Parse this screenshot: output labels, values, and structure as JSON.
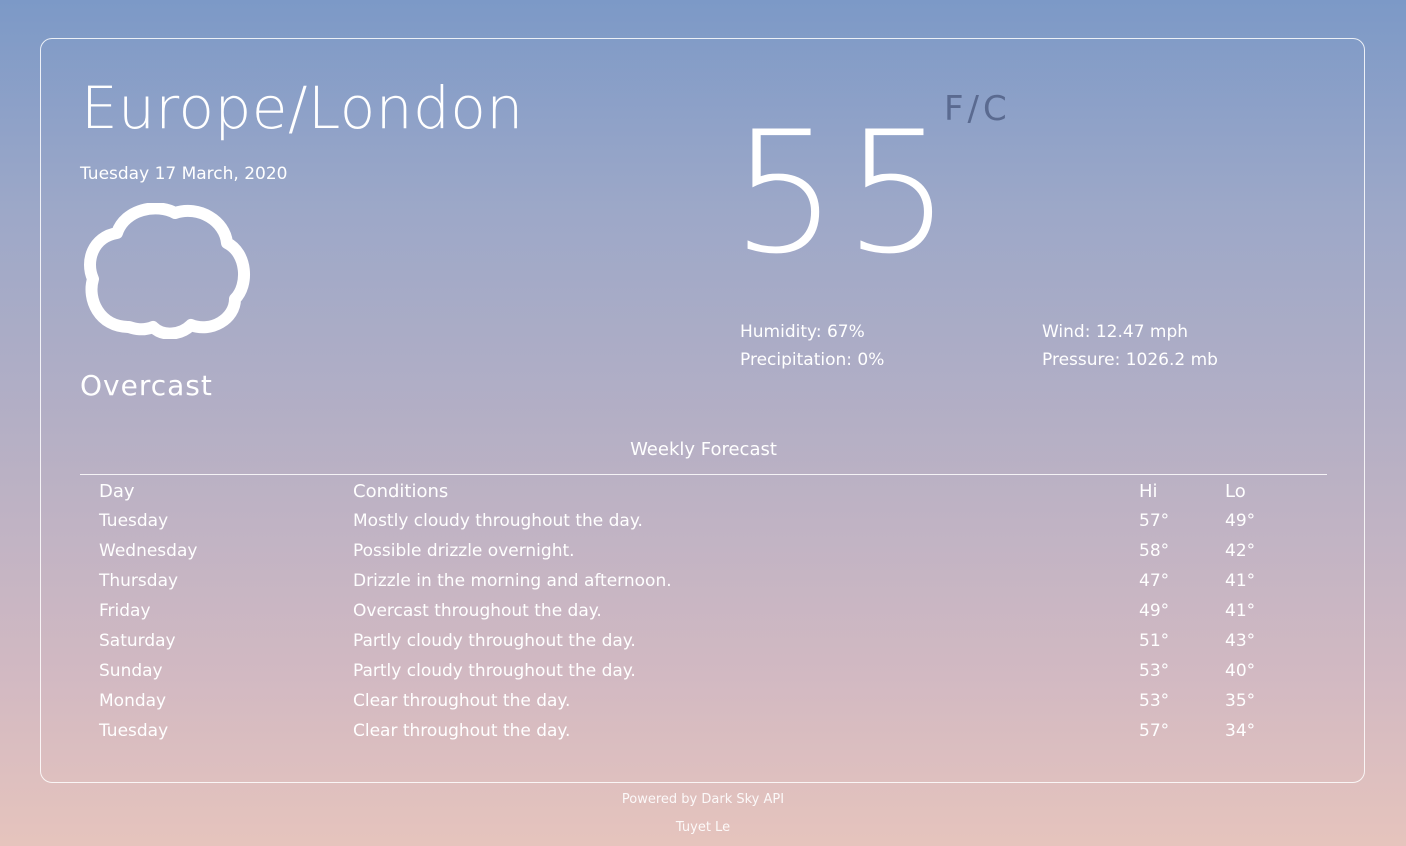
{
  "location": "Europe/London",
  "date": "Tuesday 17 March, 2020",
  "current": {
    "icon": "cloud-icon",
    "summary": "Overcast",
    "temperature": "55",
    "unit_toggle": "F/C",
    "humidity": "Humidity: 67%",
    "precipitation": "Precipitation: 0%",
    "wind": "Wind: 12.47 mph",
    "pressure": "Pressure: 1026.2 mb"
  },
  "forecast": {
    "title": "Weekly Forecast",
    "headers": {
      "day": "Day",
      "conditions": "Conditions",
      "hi": "Hi",
      "lo": "Lo"
    },
    "rows": [
      {
        "day": "Tuesday",
        "conditions": "Mostly cloudy throughout the day.",
        "hi": "57°",
        "lo": "49°"
      },
      {
        "day": "Wednesday",
        "conditions": "Possible drizzle overnight.",
        "hi": "58°",
        "lo": "42°"
      },
      {
        "day": "Thursday",
        "conditions": "Drizzle in the morning and afternoon.",
        "hi": "47°",
        "lo": "41°"
      },
      {
        "day": "Friday",
        "conditions": "Overcast throughout the day.",
        "hi": "49°",
        "lo": "41°"
      },
      {
        "day": "Saturday",
        "conditions": "Partly cloudy throughout the day.",
        "hi": "51°",
        "lo": "43°"
      },
      {
        "day": "Sunday",
        "conditions": "Partly cloudy throughout the day.",
        "hi": "53°",
        "lo": "40°"
      },
      {
        "day": "Monday",
        "conditions": "Clear throughout the day.",
        "hi": "53°",
        "lo": "35°"
      },
      {
        "day": "Tuesday",
        "conditions": "Clear throughout the day.",
        "hi": "57°",
        "lo": "34°"
      }
    ]
  },
  "footer": {
    "powered_by": "Powered by Dark Sky API",
    "author": "Tuyet Le"
  }
}
